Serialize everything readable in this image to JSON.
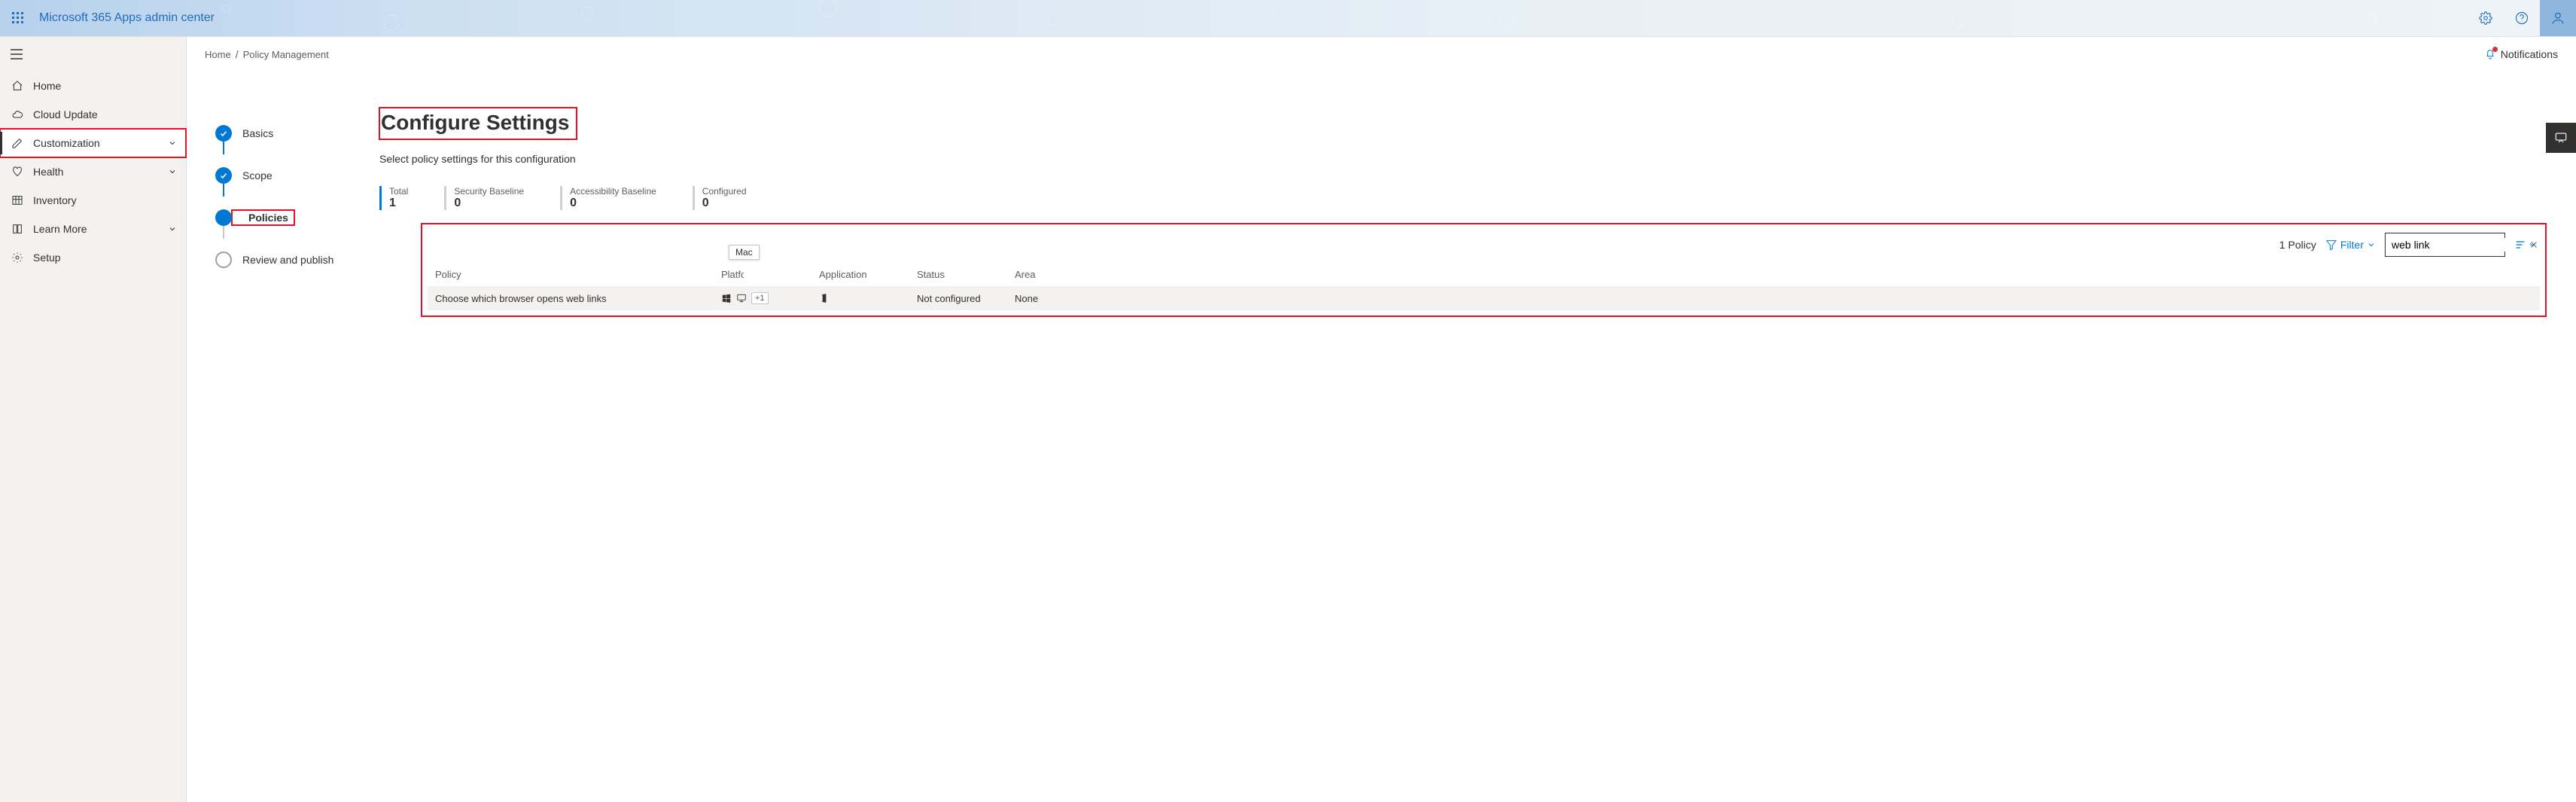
{
  "header": {
    "app_title": "Microsoft 365 Apps admin center"
  },
  "breadcrumb": {
    "items": [
      "Home",
      "Policy Management"
    ]
  },
  "notifications_label": "Notifications",
  "sidebar": {
    "items": [
      {
        "icon": "home",
        "label": "Home",
        "expandable": false
      },
      {
        "icon": "cloud",
        "label": "Cloud Update",
        "expandable": false
      },
      {
        "icon": "edit",
        "label": "Customization",
        "expandable": true,
        "active": true,
        "highlight": true
      },
      {
        "icon": "health",
        "label": "Health",
        "expandable": true
      },
      {
        "icon": "inventory",
        "label": "Inventory",
        "expandable": false
      },
      {
        "icon": "learn",
        "label": "Learn More",
        "expandable": true
      },
      {
        "icon": "setup",
        "label": "Setup",
        "expandable": false
      }
    ]
  },
  "stepper": {
    "steps": [
      {
        "label": "Basics",
        "state": "done"
      },
      {
        "label": "Scope",
        "state": "done"
      },
      {
        "label": "Policies",
        "state": "current",
        "highlight": true
      },
      {
        "label": "Review and publish",
        "state": "pending"
      }
    ]
  },
  "page": {
    "title": "Configure Settings",
    "subtitle": "Select policy settings for this configuration"
  },
  "metrics": [
    {
      "label": "Total",
      "value": "1",
      "primary": true
    },
    {
      "label": "Security Baseline",
      "value": "0"
    },
    {
      "label": "Accessibility Baseline",
      "value": "0"
    },
    {
      "label": "Configured",
      "value": "0"
    }
  ],
  "table": {
    "count_label": "1 Policy",
    "filter_label": "Filter",
    "search_value": "web link",
    "tooltip": "Mac",
    "plus_label": "+1",
    "columns": [
      "Policy",
      "Platform",
      "Application",
      "Status",
      "Area"
    ],
    "rows": [
      {
        "policy": "Choose which browser opens web links",
        "status": "Not configured",
        "area": "None"
      }
    ]
  }
}
